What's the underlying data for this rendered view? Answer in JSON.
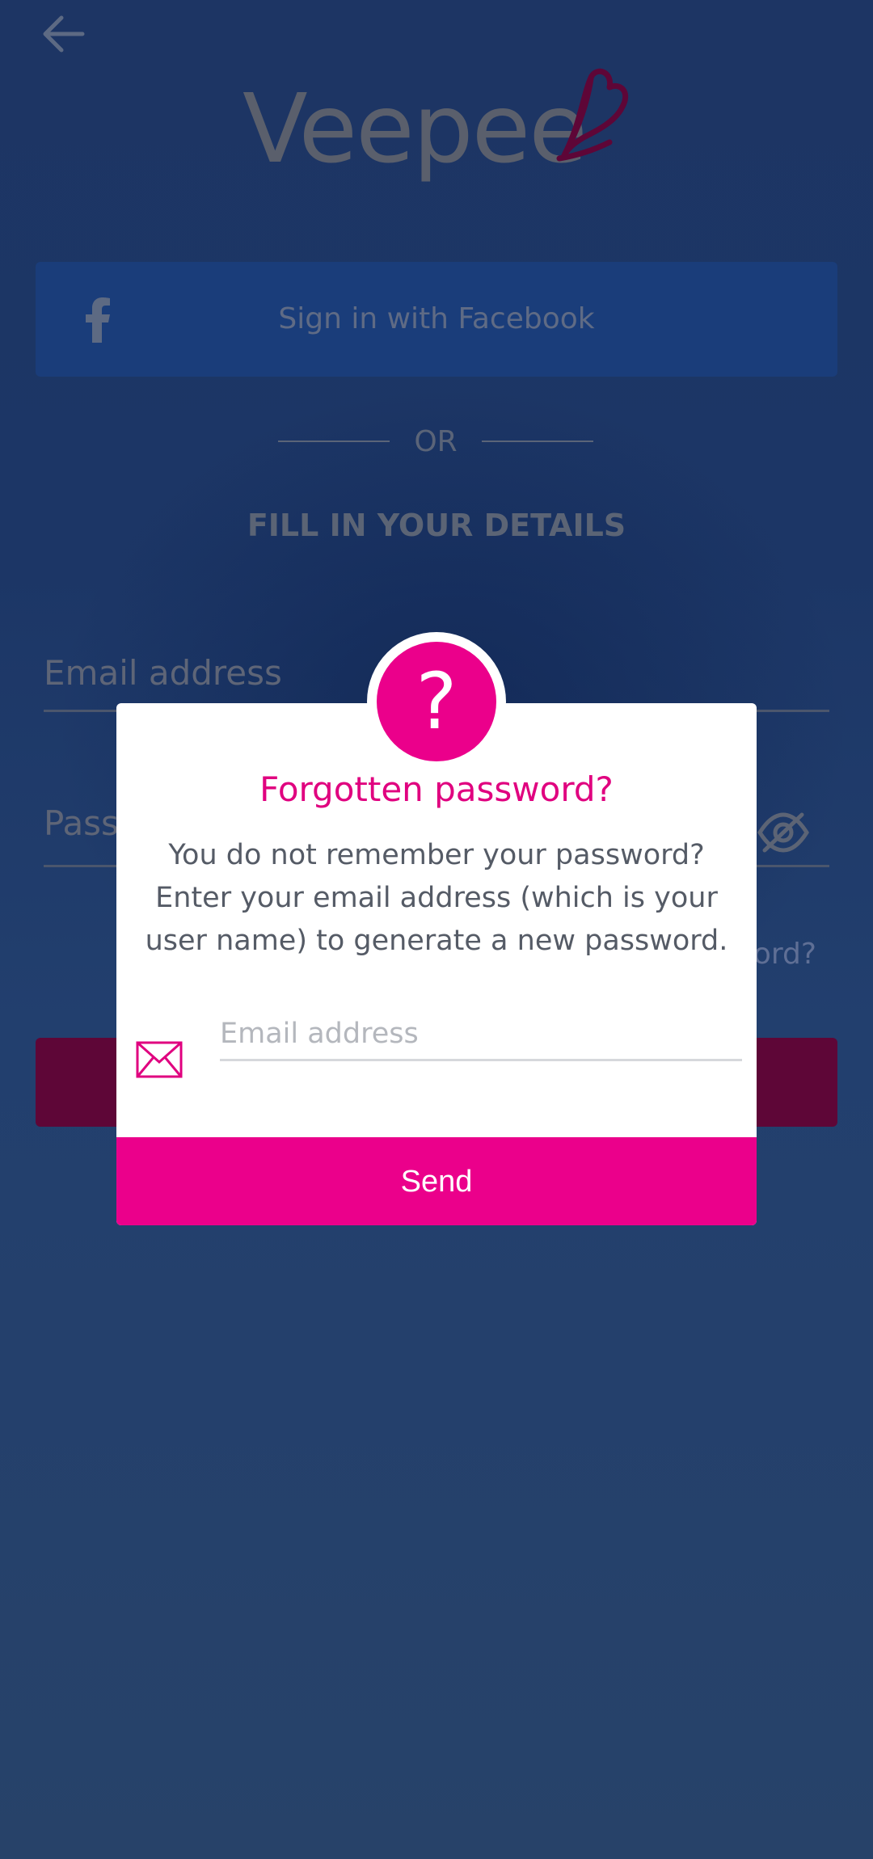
{
  "app": {
    "logo_text": "Veepee"
  },
  "colors": {
    "brand_pink": "#eb008b",
    "brand_dark_red": "#5e0637",
    "facebook_blue": "#1a3d7a",
    "background_navy": "#223f6b"
  },
  "header": {
    "back_icon": "arrow-left-icon"
  },
  "facebook": {
    "icon": "facebook-icon",
    "label": "Sign in with Facebook"
  },
  "divider": {
    "label": "OR"
  },
  "form": {
    "title": "FILL IN YOUR DETAILS",
    "email_label": "Email address",
    "password_label_visible": "Pass",
    "password_toggle_icon": "eye-off-icon",
    "forgot_link_visible": "ord?"
  },
  "modal": {
    "badge_symbol": "?",
    "badge_icon": "question-icon",
    "title": "Forgotten password?",
    "description": "You do not remember your password? Enter your email address (which is your user name) to generate a new password.",
    "email_icon": "envelope-icon",
    "email_placeholder": "Email address",
    "email_value": "",
    "send_label": "Send"
  }
}
